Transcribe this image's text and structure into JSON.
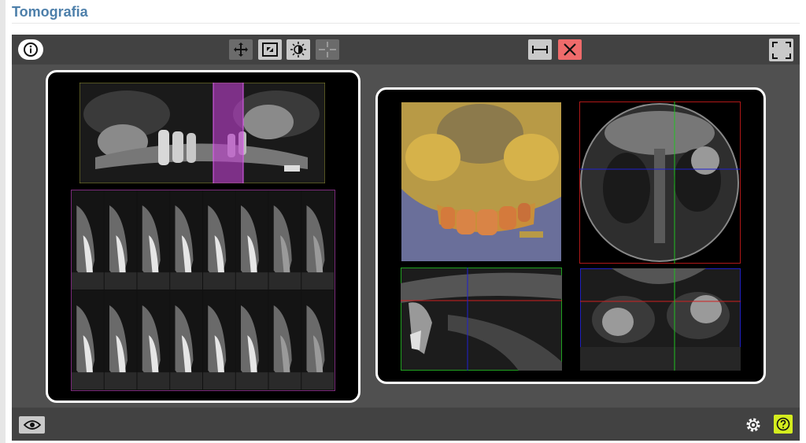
{
  "page": {
    "title": "Tomografia"
  },
  "toolbar": {
    "info_icon": "info-icon",
    "tools": [
      "move-icon",
      "fit-icon",
      "brightness-contrast-icon",
      "crosshair-icon"
    ],
    "measure_icon": "ruler-icon",
    "delete_icon": "close-icon",
    "fullscreen_icon": "fullscreen-icon"
  },
  "bottombar": {
    "visibility_icon": "eye-icon",
    "settings_icon": "gear-icon",
    "help_icon": "help-icon"
  },
  "colors": {
    "title": "#4d7faa",
    "viewer_bg": "#505050",
    "bar_bg": "#424242",
    "delete_button": "#ef6b6b",
    "help_button": "#d4ec1e",
    "panoramic_highlight": "#c040d0",
    "axis_red": "#d02020",
    "axis_green": "#20c020",
    "axis_blue": "#2020d0",
    "render_bone": "#d6b24a",
    "render_teeth": "#d47a3c",
    "render_bg": "#6a6f9a"
  },
  "left_panel": {
    "cross_section_rows": 2,
    "cross_section_cols": 8
  },
  "right_panel": {
    "views": [
      "3d-render",
      "axial-view",
      "sagittal-view",
      "coronal-view"
    ]
  }
}
